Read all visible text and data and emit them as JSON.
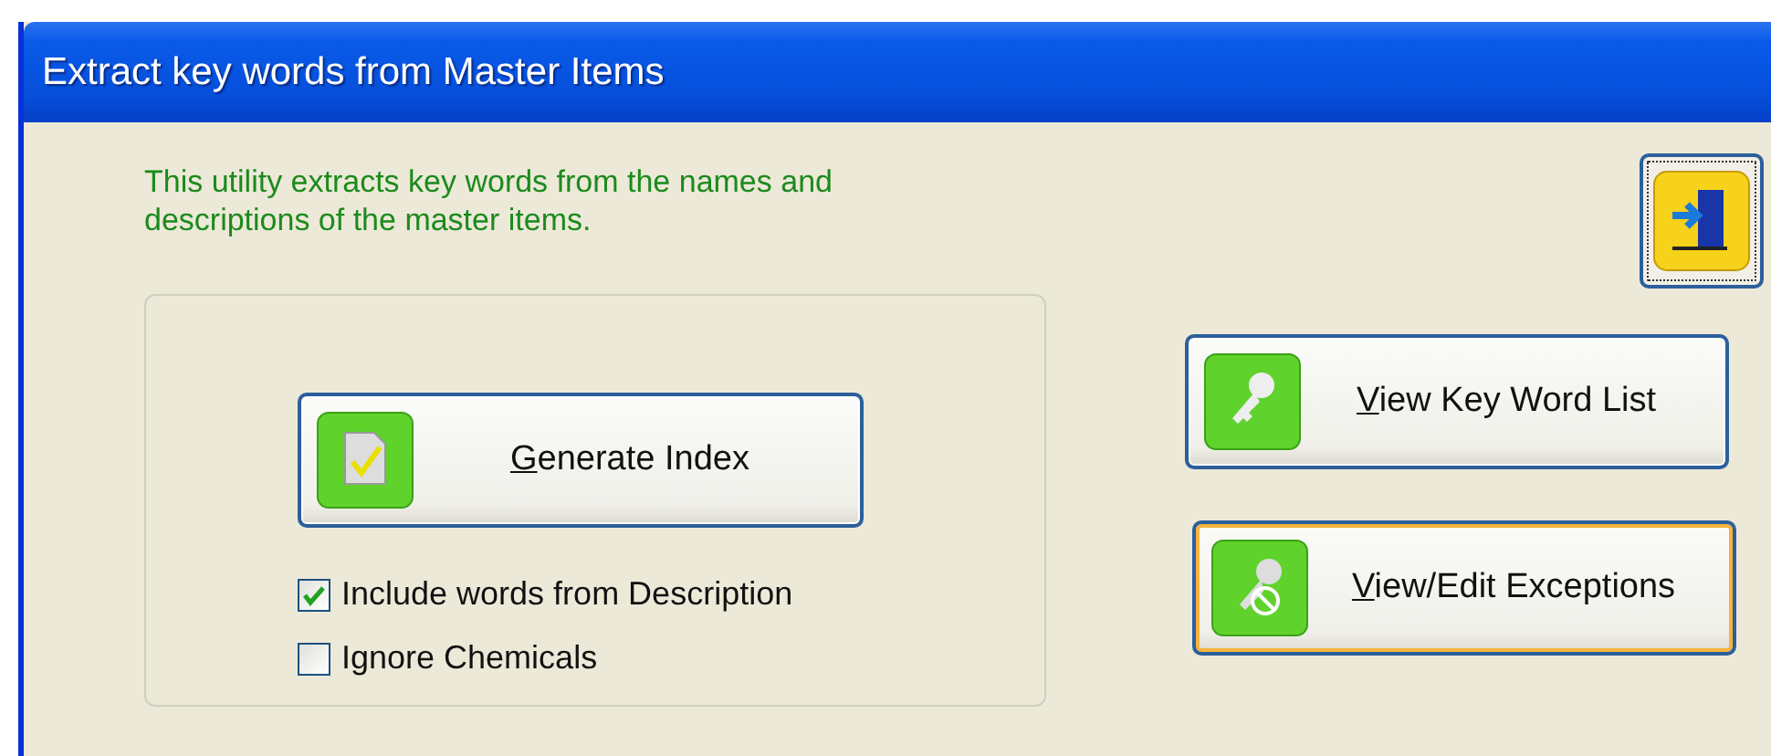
{
  "window": {
    "title": "Extract key words from Master Items"
  },
  "description": "This utility extracts key words from the names and descriptions of the master items.",
  "exit_button": {
    "kind": "exit"
  },
  "generate_button": {
    "label": "Generate Index",
    "kind": "generate",
    "focused": false
  },
  "options": [
    {
      "label": "Include words from Description",
      "checked": true
    },
    {
      "label": "Ignore Chemicals",
      "checked": false
    }
  ],
  "side_buttons": [
    {
      "label": "View Key Word List",
      "kind": "key",
      "focused": false
    },
    {
      "label": "View/Edit Exceptions",
      "kind": "exceptions",
      "focused": true
    }
  ]
}
